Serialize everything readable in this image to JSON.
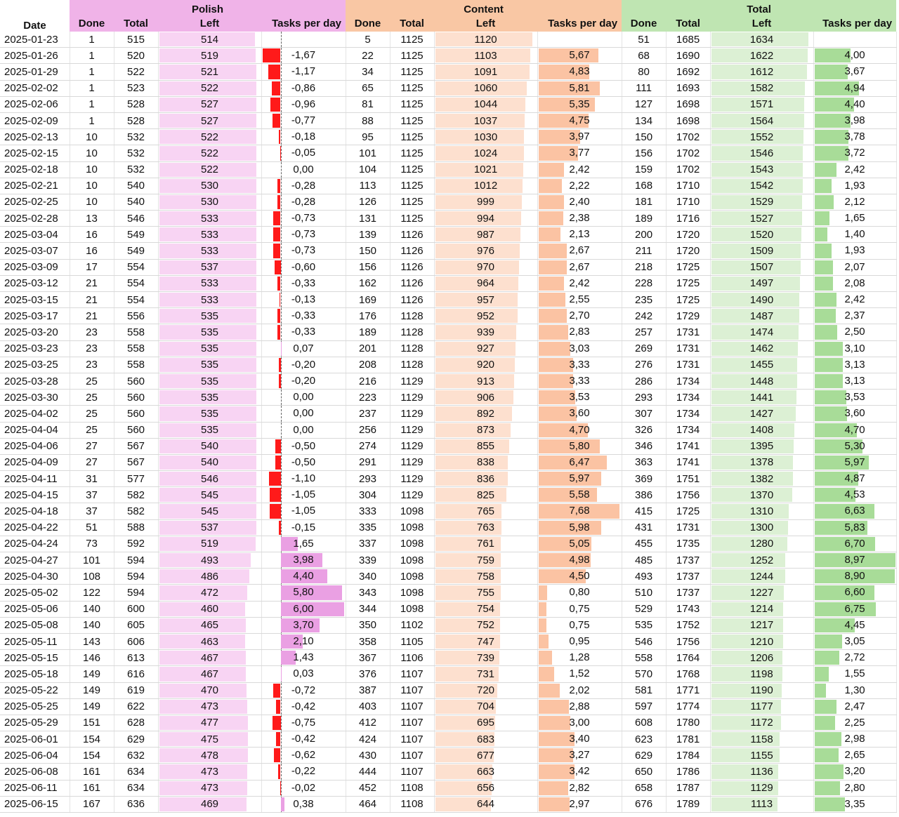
{
  "headers": {
    "date": "Date",
    "groups": [
      {
        "name": "Polish",
        "color": "#f0b3e8"
      },
      {
        "name": "Content",
        "color": "#f9c7a4"
      },
      {
        "name": "Total",
        "color": "#bfe5b2"
      }
    ],
    "sub": {
      "done": "Done",
      "total": "Total",
      "left": "Left",
      "tpd": "Tasks per day"
    }
  },
  "colors": {
    "polish_left_bar": "#f8d4f3",
    "polish_neg_bar": "#ff1a1a",
    "polish_pos_bar": "#eaa0e3",
    "content_left_bar": "#fde0cf",
    "content_tpd_bar": "#fbc3a3",
    "total_left_bar": "#dcf0d4",
    "total_tpd_bar": "#a8dc98"
  },
  "rows": [
    {
      "date": "2025-01-23",
      "p": [
        "1",
        "515",
        "514",
        ""
      ],
      "c": [
        "5",
        "1125",
        "1120",
        ""
      ],
      "t": [
        "51",
        "1685",
        "1634",
        ""
      ]
    },
    {
      "date": "2025-01-26",
      "p": [
        "1",
        "520",
        "519",
        "-1,67"
      ],
      "c": [
        "22",
        "1125",
        "1103",
        "5,67"
      ],
      "t": [
        "68",
        "1690",
        "1622",
        "4,00"
      ]
    },
    {
      "date": "2025-01-29",
      "p": [
        "1",
        "522",
        "521",
        "-1,17"
      ],
      "c": [
        "34",
        "1125",
        "1091",
        "4,83"
      ],
      "t": [
        "80",
        "1692",
        "1612",
        "3,67"
      ]
    },
    {
      "date": "2025-02-02",
      "p": [
        "1",
        "523",
        "522",
        "-0,86"
      ],
      "c": [
        "65",
        "1125",
        "1060",
        "5,81"
      ],
      "t": [
        "111",
        "1693",
        "1582",
        "4,94"
      ]
    },
    {
      "date": "2025-02-06",
      "p": [
        "1",
        "528",
        "527",
        "-0,96"
      ],
      "c": [
        "81",
        "1125",
        "1044",
        "5,35"
      ],
      "t": [
        "127",
        "1698",
        "1571",
        "4,40"
      ]
    },
    {
      "date": "2025-02-09",
      "p": [
        "1",
        "528",
        "527",
        "-0,77"
      ],
      "c": [
        "88",
        "1125",
        "1037",
        "4,75"
      ],
      "t": [
        "134",
        "1698",
        "1564",
        "3,98"
      ]
    },
    {
      "date": "2025-02-13",
      "p": [
        "10",
        "532",
        "522",
        "-0,18"
      ],
      "c": [
        "95",
        "1125",
        "1030",
        "3,97"
      ],
      "t": [
        "150",
        "1702",
        "1552",
        "3,78"
      ]
    },
    {
      "date": "2025-02-15",
      "p": [
        "10",
        "532",
        "522",
        "-0,05"
      ],
      "c": [
        "101",
        "1125",
        "1024",
        "3,77"
      ],
      "t": [
        "156",
        "1702",
        "1546",
        "3,72"
      ]
    },
    {
      "date": "2025-02-18",
      "p": [
        "10",
        "532",
        "522",
        "0,00"
      ],
      "c": [
        "104",
        "1125",
        "1021",
        "2,42"
      ],
      "t": [
        "159",
        "1702",
        "1543",
        "2,42"
      ]
    },
    {
      "date": "2025-02-21",
      "p": [
        "10",
        "540",
        "530",
        "-0,28"
      ],
      "c": [
        "113",
        "1125",
        "1012",
        "2,22"
      ],
      "t": [
        "168",
        "1710",
        "1542",
        "1,93"
      ]
    },
    {
      "date": "2025-02-25",
      "p": [
        "10",
        "540",
        "530",
        "-0,28"
      ],
      "c": [
        "126",
        "1125",
        "999",
        "2,40"
      ],
      "t": [
        "181",
        "1710",
        "1529",
        "2,12"
      ]
    },
    {
      "date": "2025-02-28",
      "p": [
        "13",
        "546",
        "533",
        "-0,73"
      ],
      "c": [
        "131",
        "1125",
        "994",
        "2,38"
      ],
      "t": [
        "189",
        "1716",
        "1527",
        "1,65"
      ]
    },
    {
      "date": "2025-03-04",
      "p": [
        "16",
        "549",
        "533",
        "-0,73"
      ],
      "c": [
        "139",
        "1126",
        "987",
        "2,13"
      ],
      "t": [
        "200",
        "1720",
        "1520",
        "1,40"
      ]
    },
    {
      "date": "2025-03-07",
      "p": [
        "16",
        "549",
        "533",
        "-0,73"
      ],
      "c": [
        "150",
        "1126",
        "976",
        "2,67"
      ],
      "t": [
        "211",
        "1720",
        "1509",
        "1,93"
      ]
    },
    {
      "date": "2025-03-09",
      "p": [
        "17",
        "554",
        "537",
        "-0,60"
      ],
      "c": [
        "156",
        "1126",
        "970",
        "2,67"
      ],
      "t": [
        "218",
        "1725",
        "1507",
        "2,07"
      ]
    },
    {
      "date": "2025-03-12",
      "p": [
        "21",
        "554",
        "533",
        "-0,33"
      ],
      "c": [
        "162",
        "1126",
        "964",
        "2,42"
      ],
      "t": [
        "228",
        "1725",
        "1497",
        "2,08"
      ]
    },
    {
      "date": "2025-03-15",
      "p": [
        "21",
        "554",
        "533",
        "-0,13"
      ],
      "c": [
        "169",
        "1126",
        "957",
        "2,55"
      ],
      "t": [
        "235",
        "1725",
        "1490",
        "2,42"
      ]
    },
    {
      "date": "2025-03-17",
      "p": [
        "21",
        "556",
        "535",
        "-0,33"
      ],
      "c": [
        "176",
        "1128",
        "952",
        "2,70"
      ],
      "t": [
        "242",
        "1729",
        "1487",
        "2,37"
      ]
    },
    {
      "date": "2025-03-20",
      "p": [
        "23",
        "558",
        "535",
        "-0,33"
      ],
      "c": [
        "189",
        "1128",
        "939",
        "2,83"
      ],
      "t": [
        "257",
        "1731",
        "1474",
        "2,50"
      ]
    },
    {
      "date": "2025-03-23",
      "p": [
        "23",
        "558",
        "535",
        "0,07"
      ],
      "c": [
        "201",
        "1128",
        "927",
        "3,03"
      ],
      "t": [
        "269",
        "1731",
        "1462",
        "3,10"
      ]
    },
    {
      "date": "2025-03-25",
      "p": [
        "23",
        "558",
        "535",
        "-0,20"
      ],
      "c": [
        "208",
        "1128",
        "920",
        "3,33"
      ],
      "t": [
        "276",
        "1731",
        "1455",
        "3,13"
      ]
    },
    {
      "date": "2025-03-28",
      "p": [
        "25",
        "560",
        "535",
        "-0,20"
      ],
      "c": [
        "216",
        "1129",
        "913",
        "3,33"
      ],
      "t": [
        "286",
        "1734",
        "1448",
        "3,13"
      ]
    },
    {
      "date": "2025-03-30",
      "p": [
        "25",
        "560",
        "535",
        "0,00"
      ],
      "c": [
        "223",
        "1129",
        "906",
        "3,53"
      ],
      "t": [
        "293",
        "1734",
        "1441",
        "3,53"
      ]
    },
    {
      "date": "2025-04-02",
      "p": [
        "25",
        "560",
        "535",
        "0,00"
      ],
      "c": [
        "237",
        "1129",
        "892",
        "3,60"
      ],
      "t": [
        "307",
        "1734",
        "1427",
        "3,60"
      ]
    },
    {
      "date": "2025-04-04",
      "p": [
        "25",
        "560",
        "535",
        "0,00"
      ],
      "c": [
        "256",
        "1129",
        "873",
        "4,70"
      ],
      "t": [
        "326",
        "1734",
        "1408",
        "4,70"
      ]
    },
    {
      "date": "2025-04-06",
      "p": [
        "27",
        "567",
        "540",
        "-0,50"
      ],
      "c": [
        "274",
        "1129",
        "855",
        "5,80"
      ],
      "t": [
        "346",
        "1741",
        "1395",
        "5,30"
      ]
    },
    {
      "date": "2025-04-09",
      "p": [
        "27",
        "567",
        "540",
        "-0,50"
      ],
      "c": [
        "291",
        "1129",
        "838",
        "6,47"
      ],
      "t": [
        "363",
        "1741",
        "1378",
        "5,97"
      ]
    },
    {
      "date": "2025-04-11",
      "p": [
        "31",
        "577",
        "546",
        "-1,10"
      ],
      "c": [
        "293",
        "1129",
        "836",
        "5,97"
      ],
      "t": [
        "369",
        "1751",
        "1382",
        "4,87"
      ]
    },
    {
      "date": "2025-04-15",
      "p": [
        "37",
        "582",
        "545",
        "-1,05"
      ],
      "c": [
        "304",
        "1129",
        "825",
        "5,58"
      ],
      "t": [
        "386",
        "1756",
        "1370",
        "4,53"
      ]
    },
    {
      "date": "2025-04-18",
      "p": [
        "37",
        "582",
        "545",
        "-1,05"
      ],
      "c": [
        "333",
        "1098",
        "765",
        "7,68"
      ],
      "t": [
        "415",
        "1725",
        "1310",
        "6,63"
      ]
    },
    {
      "date": "2025-04-22",
      "p": [
        "51",
        "588",
        "537",
        "-0,15"
      ],
      "c": [
        "335",
        "1098",
        "763",
        "5,98"
      ],
      "t": [
        "431",
        "1731",
        "1300",
        "5,83"
      ]
    },
    {
      "date": "2025-04-24",
      "p": [
        "73",
        "592",
        "519",
        "1,65"
      ],
      "c": [
        "337",
        "1098",
        "761",
        "5,05"
      ],
      "t": [
        "455",
        "1735",
        "1280",
        "6,70"
      ]
    },
    {
      "date": "2025-04-27",
      "p": [
        "101",
        "594",
        "493",
        "3,98"
      ],
      "c": [
        "339",
        "1098",
        "759",
        "4,98"
      ],
      "t": [
        "485",
        "1737",
        "1252",
        "8,97"
      ]
    },
    {
      "date": "2025-04-30",
      "p": [
        "108",
        "594",
        "486",
        "4,40"
      ],
      "c": [
        "340",
        "1098",
        "758",
        "4,50"
      ],
      "t": [
        "493",
        "1737",
        "1244",
        "8,90"
      ]
    },
    {
      "date": "2025-05-02",
      "p": [
        "122",
        "594",
        "472",
        "5,80"
      ],
      "c": [
        "343",
        "1098",
        "755",
        "0,80"
      ],
      "t": [
        "510",
        "1737",
        "1227",
        "6,60"
      ]
    },
    {
      "date": "2025-05-06",
      "p": [
        "140",
        "600",
        "460",
        "6,00"
      ],
      "c": [
        "344",
        "1098",
        "754",
        "0,75"
      ],
      "t": [
        "529",
        "1743",
        "1214",
        "6,75"
      ]
    },
    {
      "date": "2025-05-08",
      "p": [
        "140",
        "605",
        "465",
        "3,70"
      ],
      "c": [
        "350",
        "1102",
        "752",
        "0,75"
      ],
      "t": [
        "535",
        "1752",
        "1217",
        "4,45"
      ]
    },
    {
      "date": "2025-05-11",
      "p": [
        "143",
        "606",
        "463",
        "2,10"
      ],
      "c": [
        "358",
        "1105",
        "747",
        "0,95"
      ],
      "t": [
        "546",
        "1756",
        "1210",
        "3,05"
      ]
    },
    {
      "date": "2025-05-15",
      "p": [
        "146",
        "613",
        "467",
        "1,43"
      ],
      "c": [
        "367",
        "1106",
        "739",
        "1,28"
      ],
      "t": [
        "558",
        "1764",
        "1206",
        "2,72"
      ]
    },
    {
      "date": "2025-05-18",
      "p": [
        "149",
        "616",
        "467",
        "0,03"
      ],
      "c": [
        "376",
        "1107",
        "731",
        "1,52"
      ],
      "t": [
        "570",
        "1768",
        "1198",
        "1,55"
      ]
    },
    {
      "date": "2025-05-22",
      "p": [
        "149",
        "619",
        "470",
        "-0,72"
      ],
      "c": [
        "387",
        "1107",
        "720",
        "2,02"
      ],
      "t": [
        "581",
        "1771",
        "1190",
        "1,30"
      ]
    },
    {
      "date": "2025-05-25",
      "p": [
        "149",
        "622",
        "473",
        "-0,42"
      ],
      "c": [
        "403",
        "1107",
        "704",
        "2,88"
      ],
      "t": [
        "597",
        "1774",
        "1177",
        "2,47"
      ]
    },
    {
      "date": "2025-05-29",
      "p": [
        "151",
        "628",
        "477",
        "-0,75"
      ],
      "c": [
        "412",
        "1107",
        "695",
        "3,00"
      ],
      "t": [
        "608",
        "1780",
        "1172",
        "2,25"
      ]
    },
    {
      "date": "2025-06-01",
      "p": [
        "154",
        "629",
        "475",
        "-0,42"
      ],
      "c": [
        "424",
        "1107",
        "683",
        "3,40"
      ],
      "t": [
        "623",
        "1781",
        "1158",
        "2,98"
      ]
    },
    {
      "date": "2025-06-04",
      "p": [
        "154",
        "632",
        "478",
        "-0,62"
      ],
      "c": [
        "430",
        "1107",
        "677",
        "3,27"
      ],
      "t": [
        "629",
        "1784",
        "1155",
        "2,65"
      ]
    },
    {
      "date": "2025-06-08",
      "p": [
        "161",
        "634",
        "473",
        "-0,22"
      ],
      "c": [
        "444",
        "1107",
        "663",
        "3,42"
      ],
      "t": [
        "650",
        "1786",
        "1136",
        "3,20"
      ]
    },
    {
      "date": "2025-06-11",
      "p": [
        "161",
        "634",
        "473",
        "-0,02"
      ],
      "c": [
        "452",
        "1108",
        "656",
        "2,82"
      ],
      "t": [
        "658",
        "1787",
        "1129",
        "2,80"
      ]
    },
    {
      "date": "2025-06-15",
      "p": [
        "167",
        "636",
        "469",
        "0,38"
      ],
      "c": [
        "464",
        "1108",
        "644",
        "2,97"
      ],
      "t": [
        "676",
        "1789",
        "1113",
        "3,35"
      ]
    }
  ]
}
